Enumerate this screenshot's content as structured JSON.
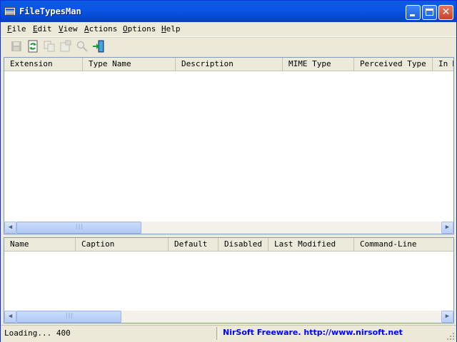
{
  "window": {
    "title": "FileTypesMan"
  },
  "menu": [
    {
      "pre": "",
      "key": "F",
      "post": "ile"
    },
    {
      "pre": "",
      "key": "E",
      "post": "dit"
    },
    {
      "pre": "",
      "key": "V",
      "post": "iew"
    },
    {
      "pre": "",
      "key": "A",
      "post": "ctions"
    },
    {
      "pre": "",
      "key": "O",
      "post": "ptions"
    },
    {
      "pre": "",
      "key": "H",
      "post": "elp"
    }
  ],
  "toolbar": {
    "icons": [
      "save-icon",
      "refresh-icon",
      "copy-icon",
      "properties-icon",
      "find-icon",
      "exit-icon"
    ]
  },
  "file_types_table": {
    "columns": [
      "Extension",
      "Type Name",
      "Description",
      "MIME Type",
      "Perceived Type",
      "In M"
    ],
    "rows": []
  },
  "actions_table": {
    "columns": [
      "Name",
      "Caption",
      "Default",
      "Disabled",
      "Last Modified",
      "Command-Line"
    ],
    "rows": []
  },
  "status": {
    "loading": "Loading... 400",
    "credit": "NirSoft Freeware.  http://www.nirsoft.net"
  },
  "colors": {
    "title_bar": "#0a5ce0",
    "link": "#0000ff"
  }
}
